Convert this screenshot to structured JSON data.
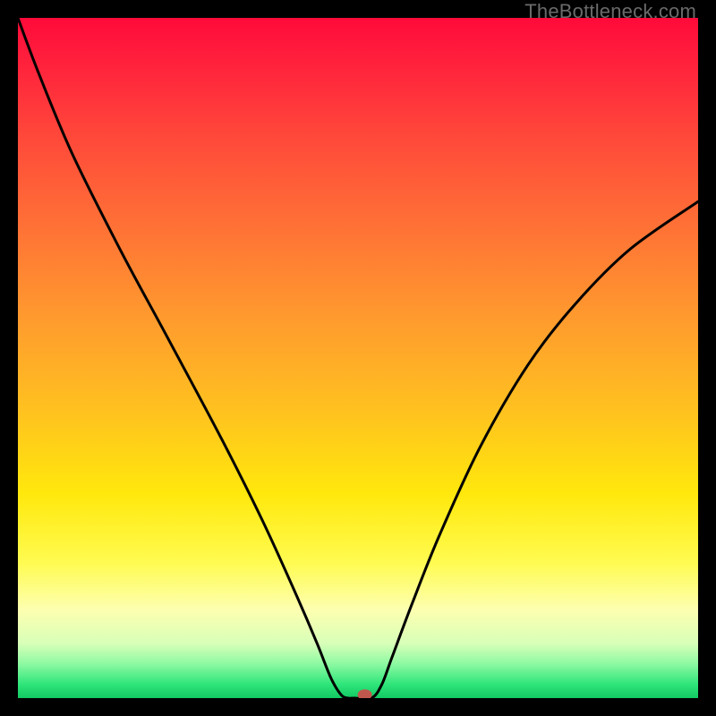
{
  "watermark": "TheBottleneck.com",
  "chart_data": {
    "type": "line",
    "title": "",
    "xlabel": "",
    "ylabel": "",
    "xlim": [
      0,
      100
    ],
    "ylim": [
      0,
      100
    ],
    "series": [
      {
        "name": "bottleneck-curve",
        "x": [
          0,
          3,
          8,
          15,
          22,
          30,
          36,
          41,
          44,
          46,
          47.5,
          48.5,
          49.5,
          52,
          53.5,
          55,
          58,
          62,
          68,
          75,
          82,
          90,
          100
        ],
        "y": [
          100,
          92,
          80,
          66,
          53,
          38,
          26,
          15,
          8,
          3,
          0.5,
          0,
          0,
          0,
          2,
          6,
          14,
          24,
          37,
          49,
          58,
          66,
          73
        ]
      }
    ],
    "marker": {
      "x": 51,
      "y": 0.5
    },
    "gradient_stops": [
      {
        "pos": 0,
        "color": "#ff0a3a"
      },
      {
        "pos": 18,
        "color": "#ff4a3a"
      },
      {
        "pos": 44,
        "color": "#ff9a2e"
      },
      {
        "pos": 70,
        "color": "#ffe80c"
      },
      {
        "pos": 87,
        "color": "#fdffb0"
      },
      {
        "pos": 95,
        "color": "#8cf9a2"
      },
      {
        "pos": 100,
        "color": "#12c963"
      }
    ]
  }
}
